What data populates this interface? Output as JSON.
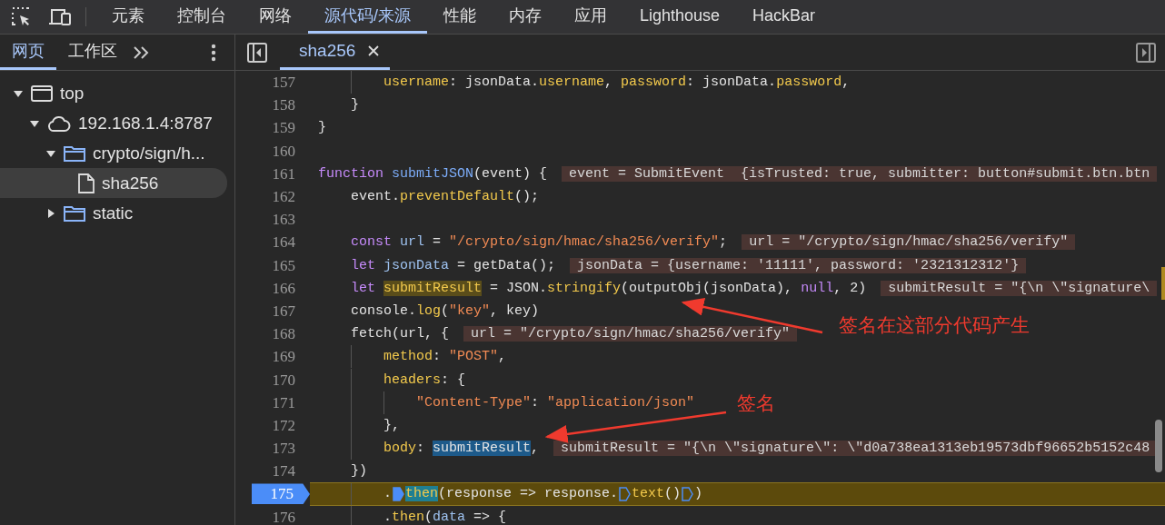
{
  "main_tabs": [
    {
      "label": "元素",
      "selected": false
    },
    {
      "label": "控制台",
      "selected": false
    },
    {
      "label": "网络",
      "selected": false
    },
    {
      "label": "源代码/来源",
      "selected": true
    },
    {
      "label": "性能",
      "selected": false
    },
    {
      "label": "内存",
      "selected": false
    },
    {
      "label": "应用",
      "selected": false
    },
    {
      "label": "Lighthouse",
      "selected": false
    },
    {
      "label": "HackBar",
      "selected": false
    }
  ],
  "sidebar": {
    "tabs": [
      {
        "label": "网页",
        "selected": true
      },
      {
        "label": "工作区",
        "selected": false
      }
    ],
    "tree": [
      {
        "label": "top",
        "kind": "frame",
        "expanded": true,
        "selected": false,
        "children": [
          {
            "label": "192.168.1.4:8787",
            "kind": "cloud",
            "expanded": true,
            "selected": false,
            "children": [
              {
                "label": "crypto/sign/h...",
                "kind": "folder",
                "expanded": true,
                "selected": false,
                "children": [
                  {
                    "label": "sha256",
                    "kind": "file",
                    "selected": true
                  }
                ]
              },
              {
                "label": "static",
                "kind": "folder",
                "expanded": false,
                "selected": false
              }
            ]
          }
        ]
      }
    ]
  },
  "editor": {
    "tabs": [
      {
        "label": "sha256",
        "selected": true
      }
    ],
    "lines": [
      {
        "children": [
          {
            "children": [
              {
                "number": "157",
                "breakpoint": false,
                "paused": false,
                "tokens": [
                  {
                    "kind": "prop",
                    "text": "username"
                  },
                  {
                    "kind": "plain",
                    "text": ": jsonData."
                  },
                  {
                    "kind": "prop",
                    "text": "username"
                  },
                  {
                    "kind": "plain",
                    "text": ", "
                  },
                  {
                    "kind": "prop",
                    "text": "password"
                  },
                  {
                    "kind": "plain",
                    "text": ": jsonData."
                  },
                  {
                    "kind": "prop",
                    "text": "password"
                  },
                  {
                    "kind": "plain",
                    "text": ","
                  }
                ]
              }
            ]
          },
          {
            "number": "158",
            "breakpoint": false,
            "paused": false,
            "tokens": [
              {
                "kind": "plain",
                "text": "}"
              }
            ]
          }
        ]
      },
      {
        "number": "159",
        "breakpoint": false,
        "paused": false,
        "tokens": [
          {
            "kind": "plain",
            "text": "}"
          }
        ]
      },
      {
        "number": "160",
        "breakpoint": false,
        "paused": false
      },
      {
        "number": "161",
        "breakpoint": false,
        "paused": false,
        "tokens": [
          {
            "kind": "keyword",
            "text": "function "
          },
          {
            "kind": "function",
            "text": "submitJSON"
          },
          {
            "kind": "plain",
            "text": "(event) {"
          }
        ],
        "inline_value": "event = SubmitEvent  {isTrusted: true, submitter: button#submit.btn.btn",
        "children": [
          {
            "number": "162",
            "breakpoint": false,
            "paused": false,
            "tokens": [
              {
                "kind": "plain",
                "text": "event."
              },
              {
                "kind": "prop",
                "text": "preventDefault"
              },
              {
                "kind": "plain",
                "text": "();"
              }
            ]
          },
          {
            "number": "163",
            "breakpoint": false,
            "paused": false
          },
          {
            "number": "164",
            "breakpoint": false,
            "paused": false,
            "tokens": [
              {
                "kind": "keyword",
                "text": "const "
              },
              {
                "kind": "variable",
                "text": "url"
              },
              {
                "kind": "plain",
                "text": " = "
              },
              {
                "kind": "string",
                "text": "\"/crypto/sign/hmac/sha256/verify\""
              },
              {
                "kind": "plain",
                "text": ";"
              }
            ],
            "inline_value": "url = \"/crypto/sign/hmac/sha256/verify\""
          },
          {
            "number": "165",
            "breakpoint": false,
            "paused": false,
            "tokens": [
              {
                "kind": "keyword",
                "text": "let "
              },
              {
                "kind": "variable",
                "text": "jsonData"
              },
              {
                "kind": "plain",
                "text": " = getData();"
              }
            ],
            "inline_value": "jsonData = {username: '11111', password: '2321312312'}"
          },
          {
            "number": "166",
            "breakpoint": false,
            "paused": false,
            "tokens": [
              {
                "kind": "keyword",
                "text": "let "
              },
              {
                "kind": "occurrence",
                "text": "submitResult"
              },
              {
                "kind": "plain",
                "text": " = JSON."
              },
              {
                "kind": "prop",
                "text": "stringify"
              },
              {
                "kind": "plain",
                "text": "(outputObj(jsonData), "
              },
              {
                "kind": "keyword",
                "text": "null"
              },
              {
                "kind": "plain",
                "text": ", 2)"
              }
            ],
            "inline_value": "submitResult = \"{\\n \\\"signature\\"
          },
          {
            "number": "167",
            "breakpoint": false,
            "paused": false,
            "tokens": [
              {
                "kind": "plain",
                "text": "console."
              },
              {
                "kind": "prop",
                "text": "log"
              },
              {
                "kind": "plain",
                "text": "("
              },
              {
                "kind": "string",
                "text": "\"key\""
              },
              {
                "kind": "plain",
                "text": ", key)"
              }
            ]
          },
          {
            "number": "168",
            "breakpoint": false,
            "paused": false,
            "tokens": [
              {
                "kind": "plain",
                "text": "fetch(url, {"
              }
            ],
            "inline_value": "url = \"/crypto/sign/hmac/sha256/verify\"",
            "children": [
              {
                "number": "169",
                "breakpoint": false,
                "paused": false,
                "tokens": [
                  {
                    "kind": "prop",
                    "text": "method"
                  },
                  {
                    "kind": "plain",
                    "text": ": "
                  },
                  {
                    "kind": "string",
                    "text": "\"POST\""
                  },
                  {
                    "kind": "plain",
                    "text": ","
                  }
                ]
              },
              {
                "number": "170",
                "breakpoint": false,
                "paused": false,
                "tokens": [
                  {
                    "kind": "prop",
                    "text": "headers"
                  },
                  {
                    "kind": "plain",
                    "text": ": {"
                  }
                ],
                "children": [
                  {
                    "number": "171",
                    "breakpoint": false,
                    "paused": false,
                    "tokens": [
                      {
                        "kind": "string",
                        "text": "\"Content-Type\""
                      },
                      {
                        "kind": "plain",
                        "text": ": "
                      },
                      {
                        "kind": "string",
                        "text": "\"application/json\""
                      }
                    ]
                  }
                ]
              },
              {
                "number": "172",
                "breakpoint": false,
                "paused": false,
                "tokens": [
                  {
                    "kind": "plain",
                    "text": "},"
                  }
                ]
              },
              {
                "number": "173",
                "breakpoint": false,
                "paused": false,
                "tokens": [
                  {
                    "kind": "prop",
                    "text": "body"
                  },
                  {
                    "kind": "plain",
                    "text": ": "
                  },
                  {
                    "kind": "selection",
                    "text": "submitResult"
                  },
                  {
                    "kind": "plain",
                    "text": ","
                  }
                ],
                "inline_value": "submitResult = \"{\\n \\\"signature\\\": \\\"d0a738ea1313eb19573dbf96652b5152c48"
              }
            ]
          },
          {
            "number": "174",
            "breakpoint": false,
            "paused": false,
            "tokens": [
              {
                "kind": "plain",
                "text": "})"
              }
            ],
            "children": [
              {
                "number": "175",
                "breakpoint": true,
                "paused": true,
                "tokens": [
                  {
                    "kind": "plain",
                    "text": "."
                  },
                  {
                    "kind": "marker",
                    "active": true
                  },
                  {
                    "kind": "current",
                    "text": "then"
                  },
                  {
                    "kind": "plain",
                    "text": "(response => response."
                  },
                  {
                    "kind": "marker",
                    "active": false
                  },
                  {
                    "kind": "prop",
                    "text": "text"
                  },
                  {
                    "kind": "plain",
                    "text": "()"
                  },
                  {
                    "kind": "marker",
                    "active": false
                  },
                  {
                    "kind": "plain",
                    "text": ")"
                  }
                ]
              },
              {
                "number": "176",
                "breakpoint": false,
                "paused": false,
                "tokens": [
                  {
                    "kind": "plain",
                    "text": "."
                  },
                  {
                    "kind": "prop",
                    "text": "then"
                  },
                  {
                    "kind": "plain",
                    "text": "("
                  },
                  {
                    "kind": "variable",
                    "text": "data"
                  },
                  {
                    "kind": "plain",
                    "text": " => {"
                  }
                ]
              }
            ]
          }
        ]
      }
    ]
  },
  "annotations": [
    {
      "text": "签名在这部分代码产生"
    },
    {
      "text": "签名"
    }
  ]
}
